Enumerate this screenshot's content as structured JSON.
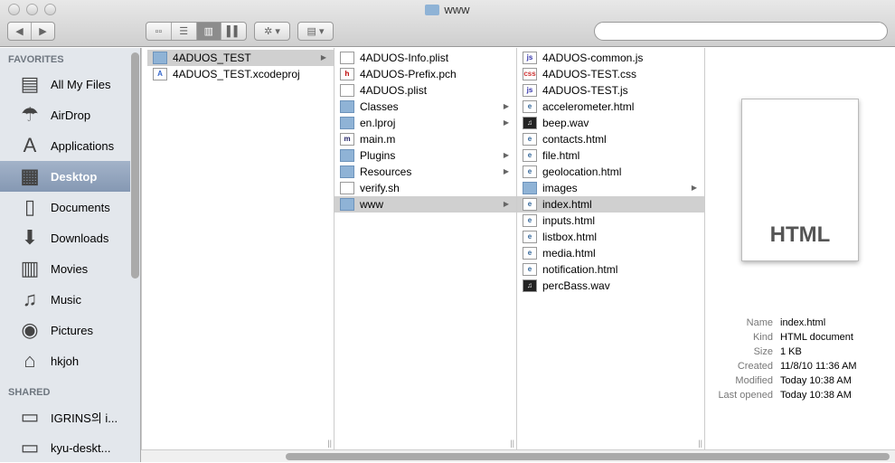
{
  "window": {
    "title": "www"
  },
  "toolbar": {
    "views": [
      "icon-view",
      "list-view",
      "column-view",
      "coverflow-view"
    ],
    "active_view": "column-view",
    "search_placeholder": ""
  },
  "sidebar": {
    "favorites_header": "FAVORITES",
    "favorites": [
      {
        "label": "All My Files",
        "icon": "all-files-icon",
        "glyph": "▤"
      },
      {
        "label": "AirDrop",
        "icon": "airdrop-icon",
        "glyph": "☂"
      },
      {
        "label": "Applications",
        "icon": "applications-icon",
        "glyph": "A"
      },
      {
        "label": "Desktop",
        "icon": "desktop-icon",
        "glyph": "▦",
        "selected": true
      },
      {
        "label": "Documents",
        "icon": "documents-icon",
        "glyph": "▯"
      },
      {
        "label": "Downloads",
        "icon": "downloads-icon",
        "glyph": "⬇"
      },
      {
        "label": "Movies",
        "icon": "movies-icon",
        "glyph": "▥"
      },
      {
        "label": "Music",
        "icon": "music-icon",
        "glyph": "♫"
      },
      {
        "label": "Pictures",
        "icon": "pictures-icon",
        "glyph": "◉"
      },
      {
        "label": "hkjoh",
        "icon": "home-icon",
        "glyph": "⌂"
      }
    ],
    "shared_header": "SHARED",
    "shared": [
      {
        "label": "IGRINS의 i...",
        "icon": "computer-icon",
        "glyph": "▭"
      },
      {
        "label": "kyu-deskt...",
        "icon": "computer-icon",
        "glyph": "▭"
      }
    ]
  },
  "columns": [
    [
      {
        "name": "4ADUOS_TEST",
        "type": "folder",
        "selected": true
      },
      {
        "name": "4ADUOS_TEST.xcodeproj",
        "type": "xcodeproj"
      }
    ],
    [
      {
        "name": "4ADUOS-Info.plist",
        "type": "file"
      },
      {
        "name": "4ADUOS-Prefix.pch",
        "type": "h"
      },
      {
        "name": "4ADUOS.plist",
        "type": "file"
      },
      {
        "name": "Classes",
        "type": "folder"
      },
      {
        "name": "en.lproj",
        "type": "folder"
      },
      {
        "name": "main.m",
        "type": "m"
      },
      {
        "name": "Plugins",
        "type": "folder"
      },
      {
        "name": "Resources",
        "type": "folder"
      },
      {
        "name": "verify.sh",
        "type": "file"
      },
      {
        "name": "www",
        "type": "folder",
        "selected": true
      }
    ],
    [
      {
        "name": "4ADUOS-common.js",
        "type": "js"
      },
      {
        "name": "4ADUOS-TEST.css",
        "type": "css"
      },
      {
        "name": "4ADUOS-TEST.js",
        "type": "js"
      },
      {
        "name": "accelerometer.html",
        "type": "html"
      },
      {
        "name": "beep.wav",
        "type": "wav"
      },
      {
        "name": "contacts.html",
        "type": "html"
      },
      {
        "name": "file.html",
        "type": "html"
      },
      {
        "name": "geolocation.html",
        "type": "html"
      },
      {
        "name": "images",
        "type": "folder"
      },
      {
        "name": "index.html",
        "type": "html",
        "selected": true
      },
      {
        "name": "inputs.html",
        "type": "html"
      },
      {
        "name": "listbox.html",
        "type": "html"
      },
      {
        "name": "media.html",
        "type": "html"
      },
      {
        "name": "notification.html",
        "type": "html"
      },
      {
        "name": "percBass.wav",
        "type": "wav"
      }
    ]
  ],
  "preview": {
    "thumbnail_label": "HTML",
    "info": [
      {
        "k": "Name",
        "v": "index.html"
      },
      {
        "k": "Kind",
        "v": "HTML document"
      },
      {
        "k": "Size",
        "v": "1 KB"
      },
      {
        "k": "Created",
        "v": "11/8/10 11:36 AM"
      },
      {
        "k": "Modified",
        "v": "Today 10:38 AM"
      },
      {
        "k": "Last opened",
        "v": "Today 10:38 AM"
      }
    ]
  }
}
